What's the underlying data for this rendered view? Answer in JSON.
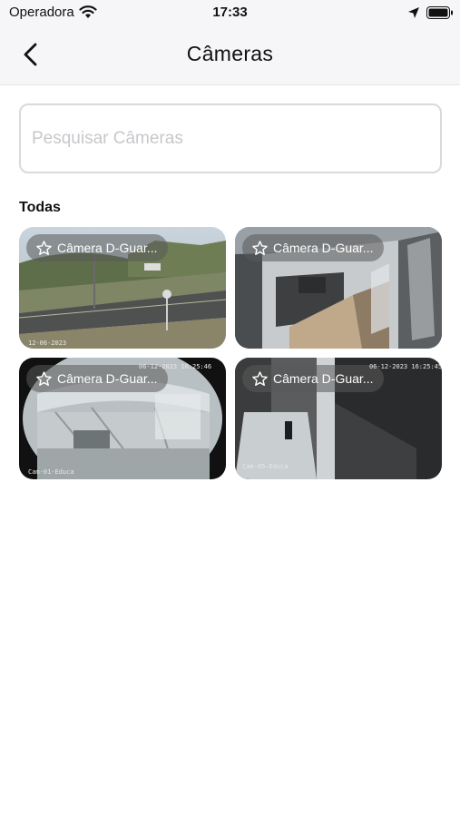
{
  "status_bar": {
    "carrier": "Operadora",
    "time": "17:33",
    "icons": [
      "wifi-icon",
      "location-arrow-icon",
      "battery-icon"
    ]
  },
  "nav": {
    "back_icon": "chevron-left-icon",
    "title": "Câmeras"
  },
  "search": {
    "placeholder": "Pesquisar Câmeras",
    "value": ""
  },
  "section": {
    "title": "Todas"
  },
  "cameras": [
    {
      "name": "Câmera D-Guar...",
      "favorite_icon": "star-outline-icon",
      "overlay_bottom": "12-06-2023"
    },
    {
      "name": "Câmera D-Guar...",
      "favorite_icon": "star-outline-icon",
      "overlay_bottom": ""
    },
    {
      "name": "Câmera D-Guar...",
      "favorite_icon": "star-outline-icon",
      "overlay_top": "06-12-2023 16:25:46",
      "overlay_bottom": "Cam-01-Educa"
    },
    {
      "name": "Câmera D-Guar...",
      "favorite_icon": "star-outline-icon",
      "overlay_top": "06-12-2023 16:25:45",
      "overlay_bottom": "Cam-05-Educa"
    }
  ],
  "colors": {
    "bar_background": "#f6f6f8",
    "search_border": "#d9d9de",
    "placeholder": "#c8c8cc",
    "chip_background": "rgba(90,90,90,0.55)"
  }
}
